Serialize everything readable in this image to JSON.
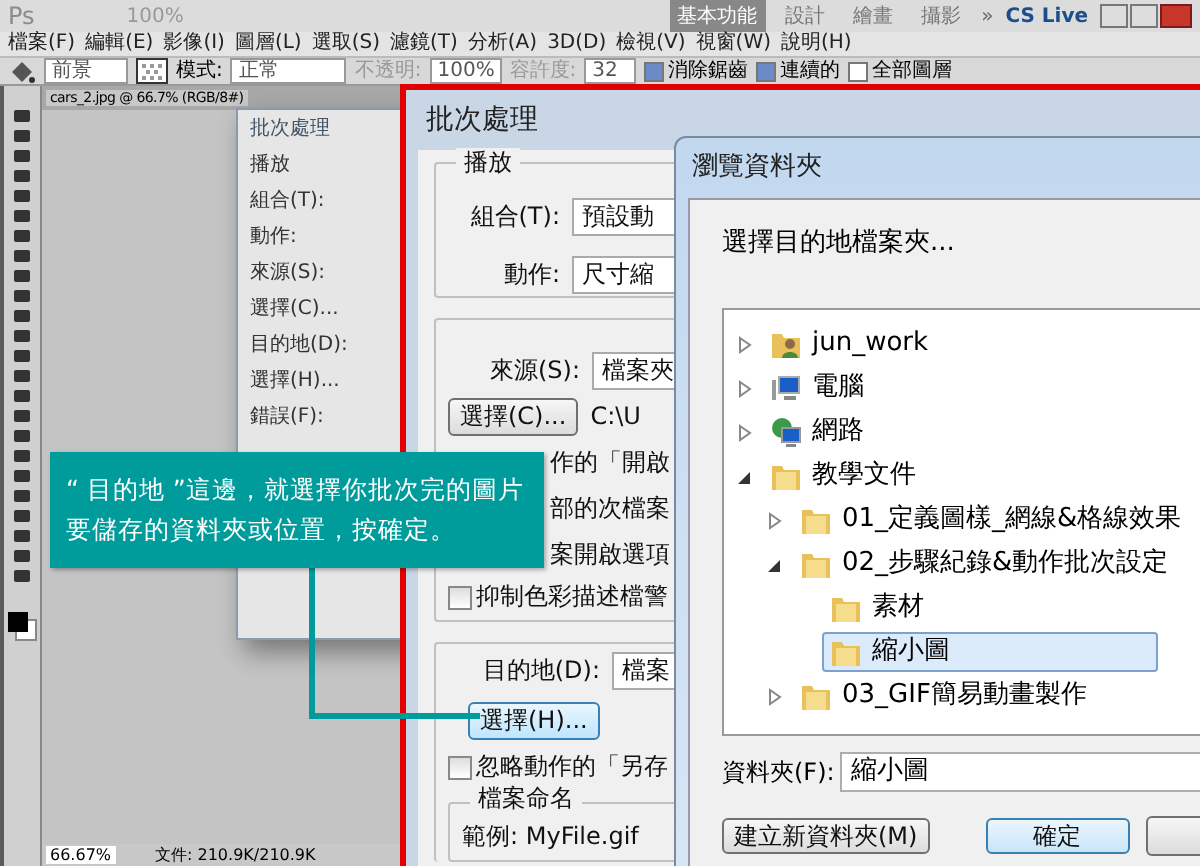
{
  "app_bar": {
    "logo": "Ps",
    "zoom": "100%",
    "workspaces": [
      {
        "label": "基本功能",
        "selected": true
      },
      {
        "label": "設計",
        "selected": false
      },
      {
        "label": "繪畫",
        "selected": false
      },
      {
        "label": "攝影",
        "selected": false
      }
    ],
    "more": "»",
    "cs_live": "CS Live"
  },
  "menu": [
    "檔案(F)",
    "編輯(E)",
    "影像(I)",
    "圖層(L)",
    "選取(S)",
    "濾鏡(T)",
    "分析(A)",
    "3D(D)",
    "檢視(V)",
    "視窗(W)",
    "說明(H)"
  ],
  "options_bar": {
    "preset": "前景",
    "mode_label": "模式:",
    "mode": "正常",
    "opacity_label": "不透明:",
    "opacity": "100%",
    "tolerance_label": "容許度:",
    "tolerance": "32",
    "checks": [
      {
        "label": "消除鋸齒",
        "checked": true
      },
      {
        "label": "連續的",
        "checked": true
      },
      {
        "label": "全部圖層",
        "checked": false
      }
    ]
  },
  "document": {
    "tab": "cars_2.jpg @ 66.7% (RGB/8#)",
    "zoom": "66.67%",
    "file_info": "文件: 210.9K/210.9K"
  },
  "small_dialog": {
    "title": "批次處理",
    "labels": [
      "播放",
      "組合(T):",
      "動作:",
      "來源(S):",
      "選擇(C)...",
      "目的地(D):",
      "選擇(H)...",
      "錯誤(F):"
    ]
  },
  "batch_dialog": {
    "title": "批次處理",
    "play_group": "播放",
    "set_label": "組合(T):",
    "set_value": "預設動",
    "action_label": "動作:",
    "action_value": "尺寸縮",
    "source_label": "來源(S):",
    "source_value": "檔案夾",
    "source_button": "選擇(C)...",
    "source_path": "C:\\U",
    "source_fragments": [
      "作的「開啟",
      "部的次檔案",
      "案開啟選項"
    ],
    "source_check": {
      "label": "抑制色彩描述檔警",
      "checked": false
    },
    "dest_label": "目的地(D):",
    "dest_value": "檔案",
    "dest_button": "選擇(H)...",
    "dest_check": {
      "label": "忽略動作的「另存",
      "checked": false
    },
    "naming_group": "檔案命名",
    "example": "範例: MyFile.gif"
  },
  "browse_dialog": {
    "title": "瀏覽資料夾",
    "prompt": "選擇目的地檔案夾...",
    "tree": [
      {
        "label": "jun_work",
        "kind": "user",
        "expanded": false,
        "selected": false
      },
      {
        "label": "電腦",
        "kind": "computer",
        "expanded": false,
        "selected": false
      },
      {
        "label": "網路",
        "kind": "network",
        "expanded": false,
        "selected": false
      },
      {
        "label": "教學文件",
        "kind": "folder",
        "expanded": true,
        "selected": false,
        "children": [
          {
            "label": "01_定義圖樣_網線&格線效果",
            "kind": "folder",
            "expanded": false,
            "selected": false
          },
          {
            "label": "02_步驟紀錄&動作批次設定",
            "kind": "folder",
            "expanded": true,
            "selected": false,
            "children": [
              {
                "label": "素材",
                "kind": "folder",
                "selected": false
              },
              {
                "label": "縮小圖",
                "kind": "folder",
                "selected": true
              }
            ]
          },
          {
            "label": "03_GIF簡易動畫製作",
            "kind": "folder",
            "expanded": false,
            "selected": false
          }
        ]
      }
    ],
    "folder_label": "資料夾(F):",
    "folder_value": "縮小圖",
    "buttons": [
      "建立新資料夾(M)",
      "確定"
    ]
  },
  "callout": {
    "text": "“ 目的地 ”這邊，就選擇你批次完的圖片要儲存的資料夾或位置，按確定。"
  }
}
